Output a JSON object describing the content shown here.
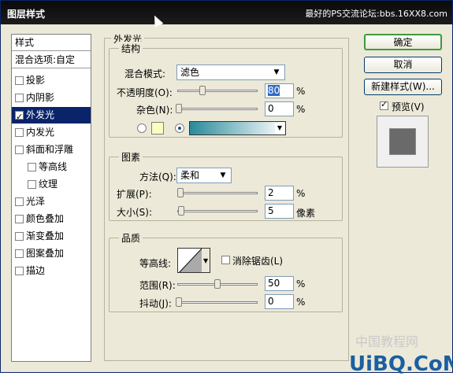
{
  "window": {
    "title": "图层样式",
    "banner": "最好的PS交流论坛:bbs.16XX8.com"
  },
  "sidebar": {
    "header": "样式",
    "blend": "混合选项:自定",
    "items": [
      {
        "label": "投影",
        "checked": false
      },
      {
        "label": "内阴影",
        "checked": false
      },
      {
        "label": "外发光",
        "checked": true,
        "selected": true
      },
      {
        "label": "内发光",
        "checked": false
      },
      {
        "label": "斜面和浮雕",
        "checked": false
      },
      {
        "label": "等高线",
        "checked": false,
        "sub": true
      },
      {
        "label": "纹理",
        "checked": false,
        "sub": true
      },
      {
        "label": "光泽",
        "checked": false
      },
      {
        "label": "颜色叠加",
        "checked": false
      },
      {
        "label": "渐变叠加",
        "checked": false
      },
      {
        "label": "图案叠加",
        "checked": false
      },
      {
        "label": "描边",
        "checked": false
      }
    ]
  },
  "panel": {
    "title": "外发光",
    "structure": {
      "legend": "结构",
      "blend_mode_label": "混合模式:",
      "blend_mode_value": "滤色",
      "opacity_label": "不透明度(O):",
      "opacity_value": "80",
      "noise_label": "杂色(N):",
      "noise_value": "0",
      "percent": "%"
    },
    "elements": {
      "legend": "图素",
      "method_label": "方法(Q):",
      "method_value": "柔和",
      "spread_label": "扩展(P):",
      "spread_value": "2",
      "size_label": "大小(S):",
      "size_value": "5",
      "size_unit": "像素",
      "percent": "%"
    },
    "quality": {
      "legend": "品质",
      "contour_label": "等高线:",
      "antialias_label": "消除锯齿(L)",
      "range_label": "范围(R):",
      "range_value": "50",
      "jitter_label": "抖动(J):",
      "jitter_value": "0",
      "percent": "%"
    }
  },
  "buttons": {
    "ok": "确定",
    "cancel": "取消",
    "new_style": "新建样式(W)...",
    "preview": "预览(V)"
  },
  "watermark": {
    "text": "UiBQ.CoM",
    "cn": "中国教程网"
  },
  "colors": {
    "glow_gradient_start": "#2a8a9a",
    "glow_swatch": "#fdfdc0",
    "accent": "#0a246a"
  }
}
